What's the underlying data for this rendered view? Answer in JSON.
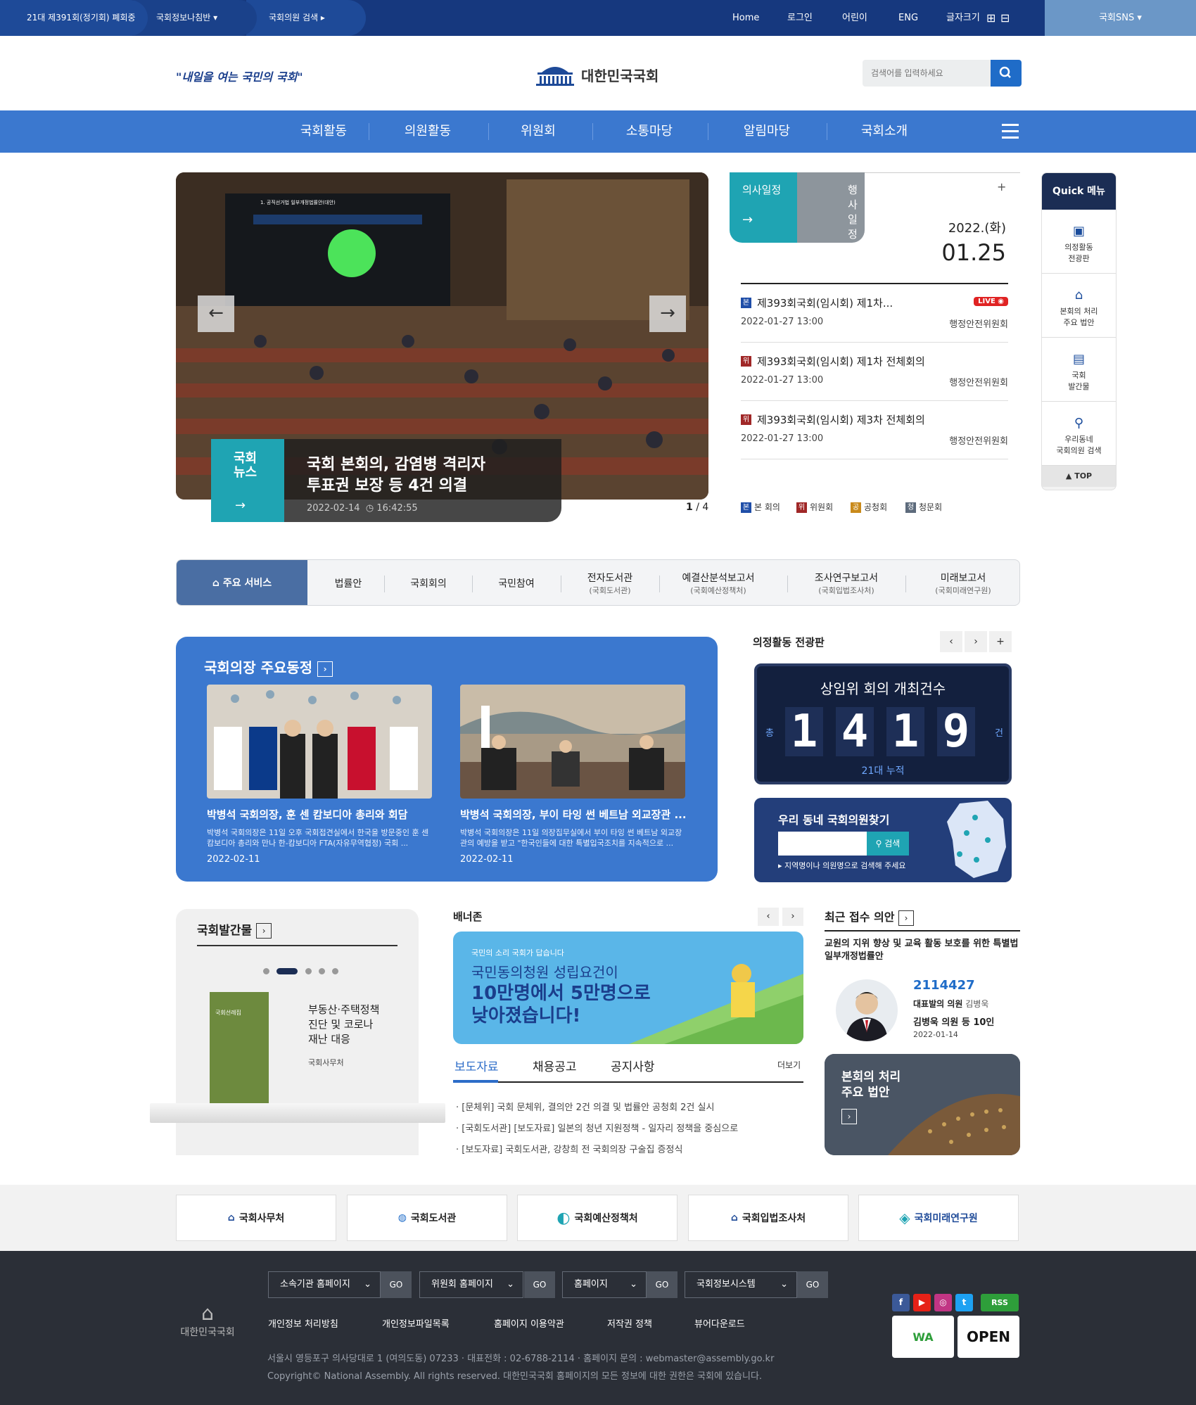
{
  "topbar": {
    "session": "21대 제391회(정기회) 폐회중",
    "info": "국회정보나침반",
    "member_search": "국회의원 검색",
    "nav": [
      "Home",
      "로그인",
      "어린이",
      "ENG",
      "글자크기"
    ],
    "sns": "국회SNS"
  },
  "header": {
    "slogan": "\"내일을 여는 국민의 국회\"",
    "logo_name": "대한민국국회",
    "search_placeholder": "검색어를 입력하세요"
  },
  "gnb": [
    "국회활동",
    "의원활동",
    "위원회",
    "소통마당",
    "알림마당",
    "국회소개"
  ],
  "hero": {
    "badge": "국회\n뉴스",
    "title1": "국회 본회의, 감염병 격리자",
    "title2": "투표권 보장 등 4건 의결",
    "date": "2022-02-14",
    "time": "16:42:55",
    "pager_current": "1",
    "pager_total": "4",
    "screen_title": "1. 공직선거법 일부개정법률안(대안)",
    "prev_arrow": "←",
    "next_arrow": "→"
  },
  "schedule": {
    "tab1": "의사일정",
    "tab2": "행사일정",
    "plus": "+",
    "year": "2022.(화)",
    "day": "01.25",
    "live": "LIVE",
    "items": [
      {
        "icon": "본",
        "color": "#1f4ea8",
        "title": "제393회국회(임시회) 제1차...",
        "date": "2022-01-27 13:00",
        "comm": "행정안전위원회"
      },
      {
        "icon": "위",
        "color": "#a02727",
        "title": "제393회국회(임시회) 제1차 전체회의",
        "date": "2022-01-27 13:00",
        "comm": "행정안전위원회"
      },
      {
        "icon": "위",
        "color": "#a02727",
        "title": "제393회국회(임시회) 제3차 전체회의",
        "date": "2022-01-27 13:00",
        "comm": "행정안전위원회"
      }
    ],
    "legend": [
      {
        "icon": "본",
        "label": "본 회의",
        "color": "#1f4ea8"
      },
      {
        "icon": "위",
        "label": "위원회",
        "color": "#a02727"
      },
      {
        "icon": "공",
        "label": "공청회",
        "color": "#c98a1b"
      },
      {
        "icon": "청",
        "label": "청문회",
        "color": "#5d6b7c"
      }
    ]
  },
  "quick": {
    "title": "Quick 메뉴",
    "items": [
      "의정활동\n전광판",
      "본회의 처리\n주요 법안",
      "국회\n발간물",
      "우리동네\n국회의원 검색"
    ],
    "top": "TOP"
  },
  "services": {
    "first": "주요 서비스",
    "items": [
      {
        "label": "법률안",
        "sub": ""
      },
      {
        "label": "국회회의",
        "sub": ""
      },
      {
        "label": "국민참여",
        "sub": ""
      },
      {
        "label": "전자도서관",
        "sub": "(국회도서관)"
      },
      {
        "label": "예결산분석보고서",
        "sub": "(국회예산정책처)"
      },
      {
        "label": "조사연구보고서",
        "sub": "(국회입법조사처)"
      },
      {
        "label": "미래보고서",
        "sub": "(국회미래연구원)"
      }
    ]
  },
  "speaker": {
    "title": "국회의장 주요동정",
    "cards": [
      {
        "title": "박병석 국회의장, 훈 센 캄보디아 총리와 회담",
        "desc": "박병석 국회의장은 11일 오후 국회접견실에서 한국을 방문중인 훈 센 캄보디아 총리와 만나 한-캄보디아 FTA(자유무역협정) 국회 ...",
        "date": "2022-02-11"
      },
      {
        "title": "박병석 국회의장, 부이 타잉 썬 베트남 외교장관 ...",
        "desc": "박병석 국회의장은 11일 의장집무실에서 부이 타잉 썬 베트남 외교장관의 예방을 받고 \"한국인들에 대한 특별입국조치를 지속적으로 ...",
        "date": "2022-02-11"
      }
    ]
  },
  "board": {
    "heading": "의정활동 전광판",
    "title": "상임위 회의 개최건수",
    "digits": [
      "1",
      "4",
      "1",
      "9"
    ],
    "prefix": "총",
    "suffix": "건",
    "footer": "21대 누적",
    "prev": "‹",
    "next": "›",
    "plus": "+"
  },
  "find": {
    "title": "우리 동네 국회의원찾기",
    "button": "검색",
    "hint": "지역명이나 의원명으로 검색해 주세요"
  },
  "pub": {
    "title": "국회발간물",
    "book_title": "부동산·주택정책\n진단 및 코로나\n재난 대응",
    "source": "국회사무처",
    "book_cover": "국회선례집"
  },
  "banner": {
    "heading": "배너존",
    "line1": "국민의 소리 국회가 답습니다",
    "line2": "국민동의청원 성립요건이",
    "line3": "10만명에서 5만명으로",
    "line4": "낮아졌습니다!"
  },
  "news": {
    "tabs": [
      "보도자료",
      "채용공고",
      "공지사항"
    ],
    "more": "더보기",
    "items": [
      "[문체위] 국회 문체위, 결의안 2건 의결 및 법률안 공청회 2건 실시",
      "[국회도서관] [보도자료] 일본의 청년 지원정책 - 일자리 정책을 중심으로",
      "[보도자료] 국회도서관, 강창희 전 국회의장 구술집 증정식"
    ]
  },
  "recent": {
    "title": "최근 접수 의안",
    "bill": "교원의 지위 향상 및 교육 활동 보호를 위한 특별법 일부개정법률안",
    "number": "2114427",
    "rep_label": "대표발의 의원",
    "rep_name": "김병욱",
    "sponsors": "김병욱 의원 등 10인",
    "date": "2022-01-14"
  },
  "plenary": {
    "title": "본회의 처리\n주요 법안"
  },
  "orgs": [
    "국회사무처",
    "국회도서관",
    "국회예산정책처",
    "국회입법조사처",
    "국회미래연구원"
  ],
  "footer": {
    "selects": [
      "소속기관 홈페이지",
      "위원회 홈페이지",
      "홈페이지",
      "국회정보시스템"
    ],
    "go": "GO",
    "links": [
      "개인정보 처리방침",
      "개인정보파일목록",
      "홈페이지 이용약관",
      "저작권 정책",
      "뷰어다운로드"
    ],
    "address": "서울시 영등포구 의사당대로 1 (여의도동) 07233   · 대표전화 : 02-6788-2114   · 홈페이지 문의 : webmaster@assembly.go.kr",
    "copyright": "Copyright© National Assembly. All rights reserved. 대한민국국회 홈페이지의 모든 정보에 대한 권한은 국회에 있습니다.",
    "logo": "대한민국국회",
    "rss": "RSS",
    "cert1": "WA",
    "cert2": "OPEN"
  }
}
